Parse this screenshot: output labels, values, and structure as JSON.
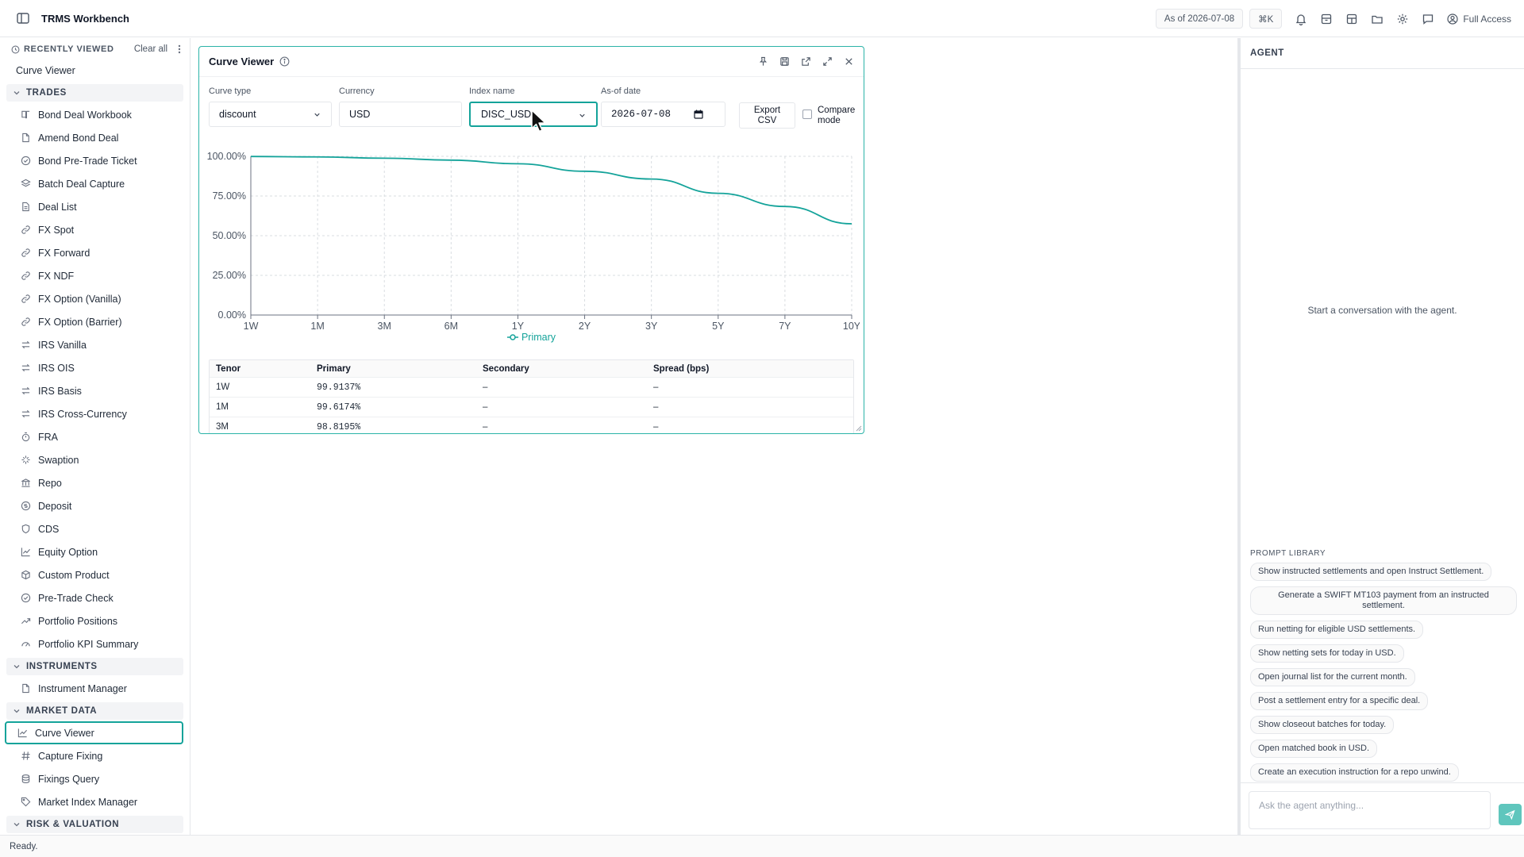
{
  "app": {
    "title": "TRMS Workbench",
    "as_of": "As of 2026-07-08",
    "shortcut": "⌘K",
    "access": "Full Access",
    "status": "Ready."
  },
  "sidebar": {
    "recent_label": "RECENTLY VIEWED",
    "clear_all": "Clear all",
    "recent": [
      "Curve Viewer"
    ],
    "sections": [
      {
        "label": "TRADES",
        "items": [
          {
            "label": "Bond Deal Workbook",
            "icon": "book-icon"
          },
          {
            "label": "Amend Bond Deal",
            "icon": "file-edit-icon"
          },
          {
            "label": "Bond Pre-Trade Ticket",
            "icon": "check-circle-icon"
          },
          {
            "label": "Batch Deal Capture",
            "icon": "layers-icon"
          },
          {
            "label": "Deal List",
            "icon": "file-text-icon"
          },
          {
            "label": "FX Spot",
            "icon": "link-icon"
          },
          {
            "label": "FX Forward",
            "icon": "link-icon"
          },
          {
            "label": "FX NDF",
            "icon": "link-icon"
          },
          {
            "label": "FX Option (Vanilla)",
            "icon": "link-icon"
          },
          {
            "label": "FX Option (Barrier)",
            "icon": "link-icon"
          },
          {
            "label": "IRS Vanilla",
            "icon": "swap-icon"
          },
          {
            "label": "IRS OIS",
            "icon": "swap-icon"
          },
          {
            "label": "IRS Basis",
            "icon": "swap-icon"
          },
          {
            "label": "IRS Cross-Currency",
            "icon": "swap-icon"
          },
          {
            "label": "FRA",
            "icon": "timer-icon"
          },
          {
            "label": "Swaption",
            "icon": "sparkle-icon"
          },
          {
            "label": "Repo",
            "icon": "bank-icon"
          },
          {
            "label": "Deposit",
            "icon": "coin-icon"
          },
          {
            "label": "CDS",
            "icon": "shield-icon"
          },
          {
            "label": "Equity Option",
            "icon": "line-chart-icon"
          },
          {
            "label": "Custom Product",
            "icon": "box-icon"
          },
          {
            "label": "Pre-Trade Check",
            "icon": "check-circle-icon"
          },
          {
            "label": "Portfolio Positions",
            "icon": "trend-icon"
          },
          {
            "label": "Portfolio KPI Summary",
            "icon": "gauge-icon"
          }
        ]
      },
      {
        "label": "INSTRUMENTS",
        "items": [
          {
            "label": "Instrument Manager",
            "icon": "file-edit-icon"
          }
        ]
      },
      {
        "label": "MARKET DATA",
        "items": [
          {
            "label": "Curve Viewer",
            "icon": "line-chart-icon",
            "active": true
          },
          {
            "label": "Capture Fixing",
            "icon": "hash-icon"
          },
          {
            "label": "Fixings Query",
            "icon": "database-icon"
          },
          {
            "label": "Market Index Manager",
            "icon": "tag-icon"
          }
        ]
      },
      {
        "label": "RISK & VALUATION",
        "items": []
      }
    ]
  },
  "panel": {
    "title": "Curve Viewer",
    "controls": {
      "curve_type_label": "Curve type",
      "curve_type": "discount",
      "currency_label": "Currency",
      "currency": "USD",
      "index_label": "Index name",
      "index": "DISC_USD",
      "asof_label": "As-of date",
      "asof": "2026-07-08",
      "export_line1": "Export",
      "export_line2": "CSV",
      "compare_line1": "Compare",
      "compare_line2": "mode"
    },
    "table": {
      "headers": [
        "Tenor",
        "Primary",
        "Secondary",
        "Spread (bps)"
      ],
      "rows": [
        [
          "1W",
          "99.9137%",
          "–",
          "–"
        ],
        [
          "1M",
          "99.6174%",
          "–",
          "–"
        ],
        [
          "3M",
          "98.8195%",
          "–",
          "–"
        ]
      ]
    }
  },
  "chart_data": {
    "type": "line",
    "categories": [
      "1W",
      "1M",
      "3M",
      "6M",
      "1Y",
      "2Y",
      "3Y",
      "5Y",
      "7Y",
      "10Y"
    ],
    "series": [
      {
        "name": "Primary",
        "values": [
          99.9137,
          99.6174,
          98.8195,
          97.6,
          95.3,
          90.6,
          85.7,
          76.7,
          68.4,
          57.5
        ],
        "color": "#14a39a"
      }
    ],
    "y_ticks": [
      "0.00%",
      "25.00%",
      "50.00%",
      "75.00%",
      "100.00%"
    ],
    "ylim": [
      0,
      100
    ],
    "grid": true,
    "legend": "bottom-center"
  },
  "agent": {
    "title": "AGENT",
    "empty": "Start a conversation with the agent.",
    "prompt_library_label": "PROMPT LIBRARY",
    "prompts": [
      "Show instructed settlements and open Instruct Settlement.",
      "Generate a SWIFT MT103 payment from an instructed settlement.",
      "Run netting for eligible USD settlements.",
      "Show netting sets for today in USD.",
      "Open journal list for the current month.",
      "Post a settlement entry for a specific deal.",
      "Show closeout batches for today.",
      "Open matched book in USD.",
      "Create an execution instruction for a repo unwind."
    ],
    "input_placeholder": "Ask the agent anything..."
  }
}
